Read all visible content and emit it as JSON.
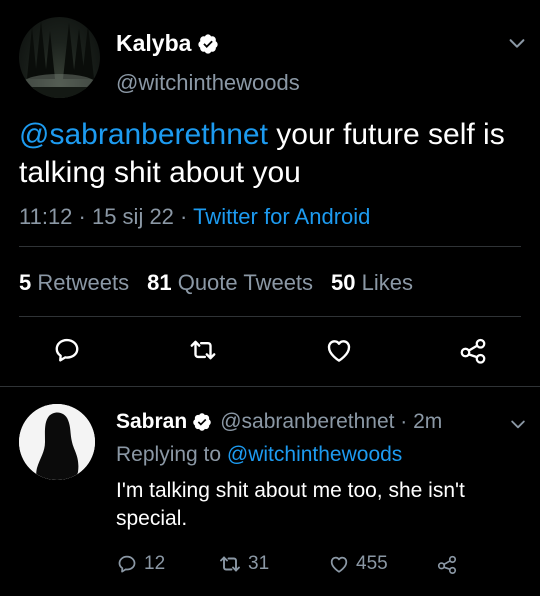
{
  "tweet": {
    "display_name": "Kalyba",
    "handle": "@witchinthewoods",
    "text_mention": "@sabranberethnet",
    "text_body": " your future self is talking shit about you",
    "timestamp": "11:12 · 15 sij 22 · ",
    "source": "Twitter for Android",
    "stats": {
      "retweets_count": "5",
      "retweets_label": "Retweets",
      "quotes_count": "81",
      "quotes_label": "Quote Tweets",
      "likes_count": "50",
      "likes_label": "Likes"
    }
  },
  "reply": {
    "display_name": "Sabran",
    "handle_time": "@sabranberethnet · 2m",
    "replying_prefix": "Replying to ",
    "replying_mention": "@witchinthewoods",
    "text": "I'm talking shit about me too, she isn't special.",
    "reply_count": "12",
    "retweet_count": "31",
    "like_count": "455"
  },
  "colors": {
    "background": "#000000",
    "link": "#1d9bf0",
    "muted": "#8b98a5",
    "divider": "#2f3336"
  }
}
